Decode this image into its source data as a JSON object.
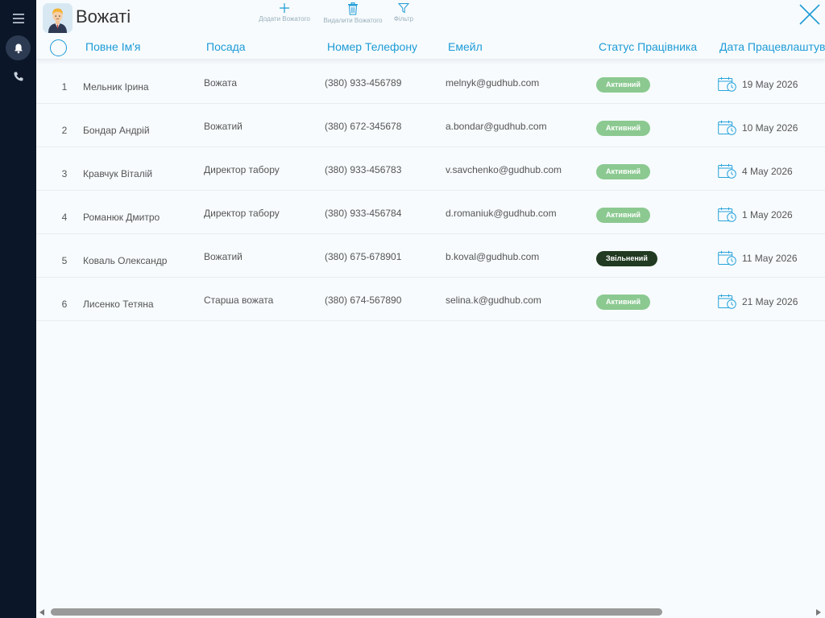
{
  "app": {
    "title": "Вожаті",
    "icon": "worker-avatar-icon"
  },
  "colors": {
    "sidebar_bg": "#0b1628",
    "accent": "#1e9bd6",
    "status_active": "#8bc990",
    "status_dismissed": "#213a21"
  },
  "sidebar": {
    "items": [
      {
        "icon": "menu-icon"
      },
      {
        "icon": "bell-icon",
        "active": true
      },
      {
        "icon": "phone-icon"
      }
    ]
  },
  "toolbar": {
    "add_label": "Додати Вожатого",
    "delete_label": "Видалити Вожатого",
    "filter_label": "Фільтр"
  },
  "table": {
    "columns": [
      "Повне Ім'я",
      "Посада",
      "Номер Телефону",
      "Емейл",
      "Статус Працівника",
      "Дата Працевлаштування"
    ],
    "rows": [
      {
        "num": "1",
        "name": "Мельник Ірина",
        "position": "Вожата",
        "phone": "(380) 933-456789",
        "email": "melnyk@gudhub.com",
        "status": "Активний",
        "date": "19 May 2026"
      },
      {
        "num": "2",
        "name": "Бондар Андрій",
        "position": "Вожатий",
        "phone": "(380) 672-345678",
        "email": "a.bondar@gudhub.com",
        "status": "Активний",
        "date": "10 May 2026"
      },
      {
        "num": "3",
        "name": "Кравчук Віталій",
        "position": "Директор табору",
        "phone": "(380) 933-456783",
        "email": "v.savchenko@gudhub.com",
        "status": "Активний",
        "date": "4 May 2026"
      },
      {
        "num": "4",
        "name": "Романюк Дмитро",
        "position": "Директор табору",
        "phone": "(380) 933-456784",
        "email": "d.romaniuk@gudhub.com",
        "status": "Активний",
        "date": "1 May 2026"
      },
      {
        "num": "5",
        "name": "Коваль Олександр",
        "position": "Вожатий",
        "phone": "(380) 675-678901",
        "email": "b.koval@gudhub.com",
        "status": "Звільнений",
        "date": "11 May 2026"
      },
      {
        "num": "6",
        "name": "Лисенко Тетяна",
        "position": "Старша вожата",
        "phone": "(380) 674-567890",
        "email": "selina.k@gudhub.com",
        "status": "Активний",
        "date": "21 May 2026"
      }
    ]
  }
}
